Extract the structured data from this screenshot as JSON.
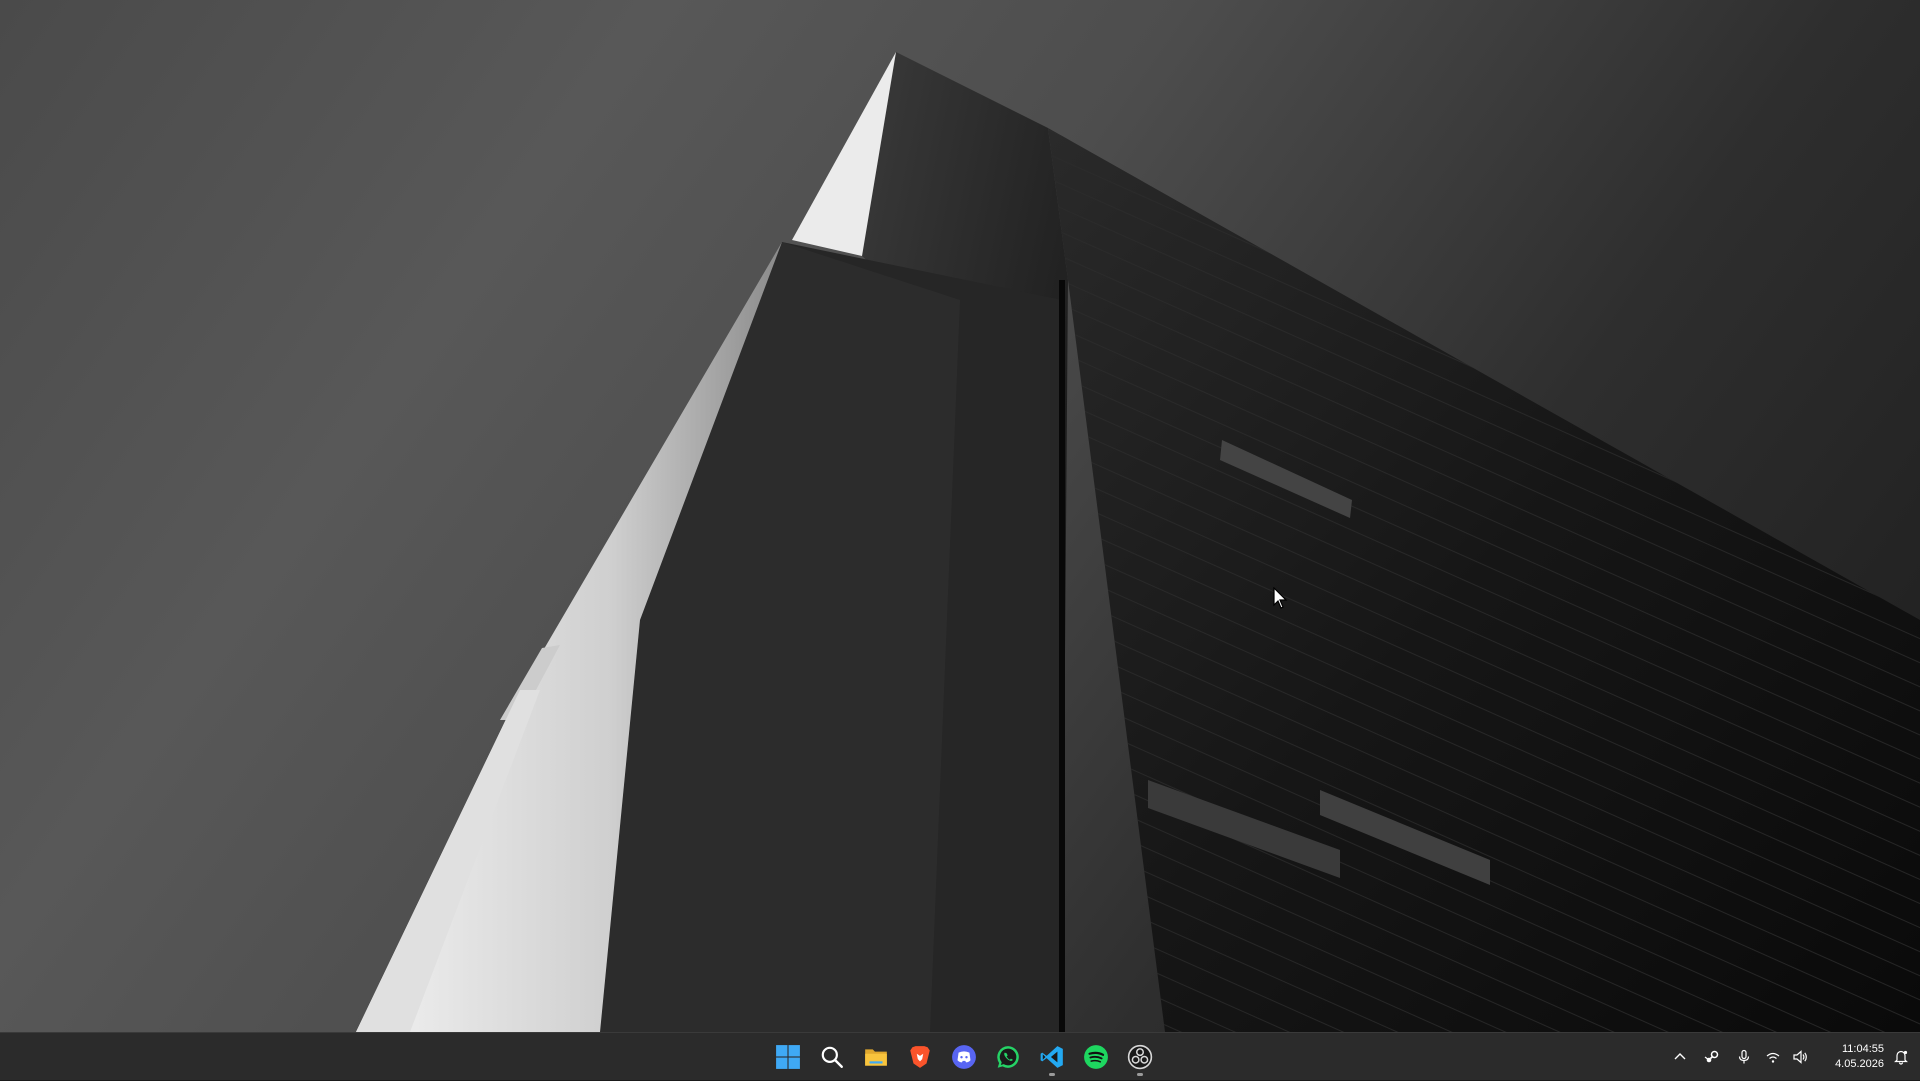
{
  "taskbar": {
    "apps": [
      {
        "name": "Start",
        "icon": "windows-start-icon",
        "running": false
      },
      {
        "name": "Search",
        "icon": "search-icon",
        "running": false
      },
      {
        "name": "File Explorer",
        "icon": "folder-icon",
        "running": false
      },
      {
        "name": "Brave",
        "icon": "brave-lion-icon",
        "running": false
      },
      {
        "name": "Discord",
        "icon": "discord-icon",
        "running": false
      },
      {
        "name": "WhatsApp",
        "icon": "whatsapp-icon",
        "running": false
      },
      {
        "name": "Visual Studio Code",
        "icon": "vscode-icon",
        "running": true
      },
      {
        "name": "Spotify",
        "icon": "spotify-icon",
        "running": false
      },
      {
        "name": "OBS Studio",
        "icon": "obs-icon",
        "running": true
      }
    ],
    "tray": {
      "icons": [
        "chevron-up-icon",
        "steam-icon",
        "microphone-icon",
        "wifi-icon",
        "volume-icon"
      ],
      "time": "11:04:55",
      "date": "4.05.2026",
      "notification_icon": "notification-bell-icon"
    },
    "colors": {
      "background": "#2b2b2b",
      "windows_blue": "#3fa9f5",
      "brave_orange": "#fb542b",
      "discord_blurple": "#5865f2",
      "whatsapp_green": "#25d366",
      "vscode_blue": "#23a9f2",
      "spotify_green": "#1ed760",
      "folder_yellow": "#f8c43d"
    }
  }
}
